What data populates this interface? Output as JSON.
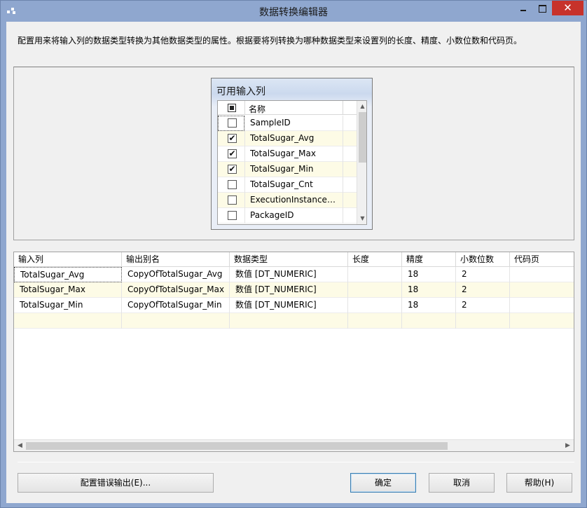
{
  "window": {
    "title": "数据转换编辑器",
    "close_glyph": "✕"
  },
  "description": "配置用来将输入列的数据类型转换为其他数据类型的属性。根据要将列转换为哪种数据类型来设置列的长度、精度、小数位数和代码页。",
  "available_columns": {
    "title": "可用输入列",
    "header_name": "名称",
    "items": [
      {
        "name": "SampleID",
        "checked": false,
        "check": ""
      },
      {
        "name": "TotalSugar_Avg",
        "checked": true,
        "check": "✔"
      },
      {
        "name": "TotalSugar_Max",
        "checked": true,
        "check": "✔"
      },
      {
        "name": "TotalSugar_Min",
        "checked": true,
        "check": "✔"
      },
      {
        "name": "TotalSugar_Cnt",
        "checked": false,
        "check": ""
      },
      {
        "name": "ExecutionInstanceG...",
        "checked": false,
        "check": ""
      },
      {
        "name": "PackageID",
        "checked": false,
        "check": ""
      }
    ]
  },
  "grid": {
    "headers": [
      "输入列",
      "输出别名",
      "数据类型",
      "长度",
      "精度",
      "小数位数",
      "代码页"
    ],
    "rows": [
      [
        "TotalSugar_Avg",
        "CopyOfTotalSugar_Avg",
        "数值 [DT_NUMERIC]",
        "",
        "18",
        "2",
        ""
      ],
      [
        "TotalSugar_Max",
        "CopyOfTotalSugar_Max",
        "数值 [DT_NUMERIC]",
        "",
        "18",
        "2",
        ""
      ],
      [
        "TotalSugar_Min",
        "CopyOfTotalSugar_Min",
        "数值 [DT_NUMERIC]",
        "",
        "18",
        "2",
        ""
      ],
      [
        "",
        "",
        "",
        "",
        "",
        "",
        ""
      ]
    ]
  },
  "buttons": {
    "error_output": "配置错误输出(E)...",
    "ok": "确定",
    "cancel": "取消",
    "help": "帮助(H)"
  },
  "icons": {
    "scroll_up": "▲",
    "scroll_down": "▼",
    "scroll_left": "◀",
    "scroll_right": "▶"
  }
}
